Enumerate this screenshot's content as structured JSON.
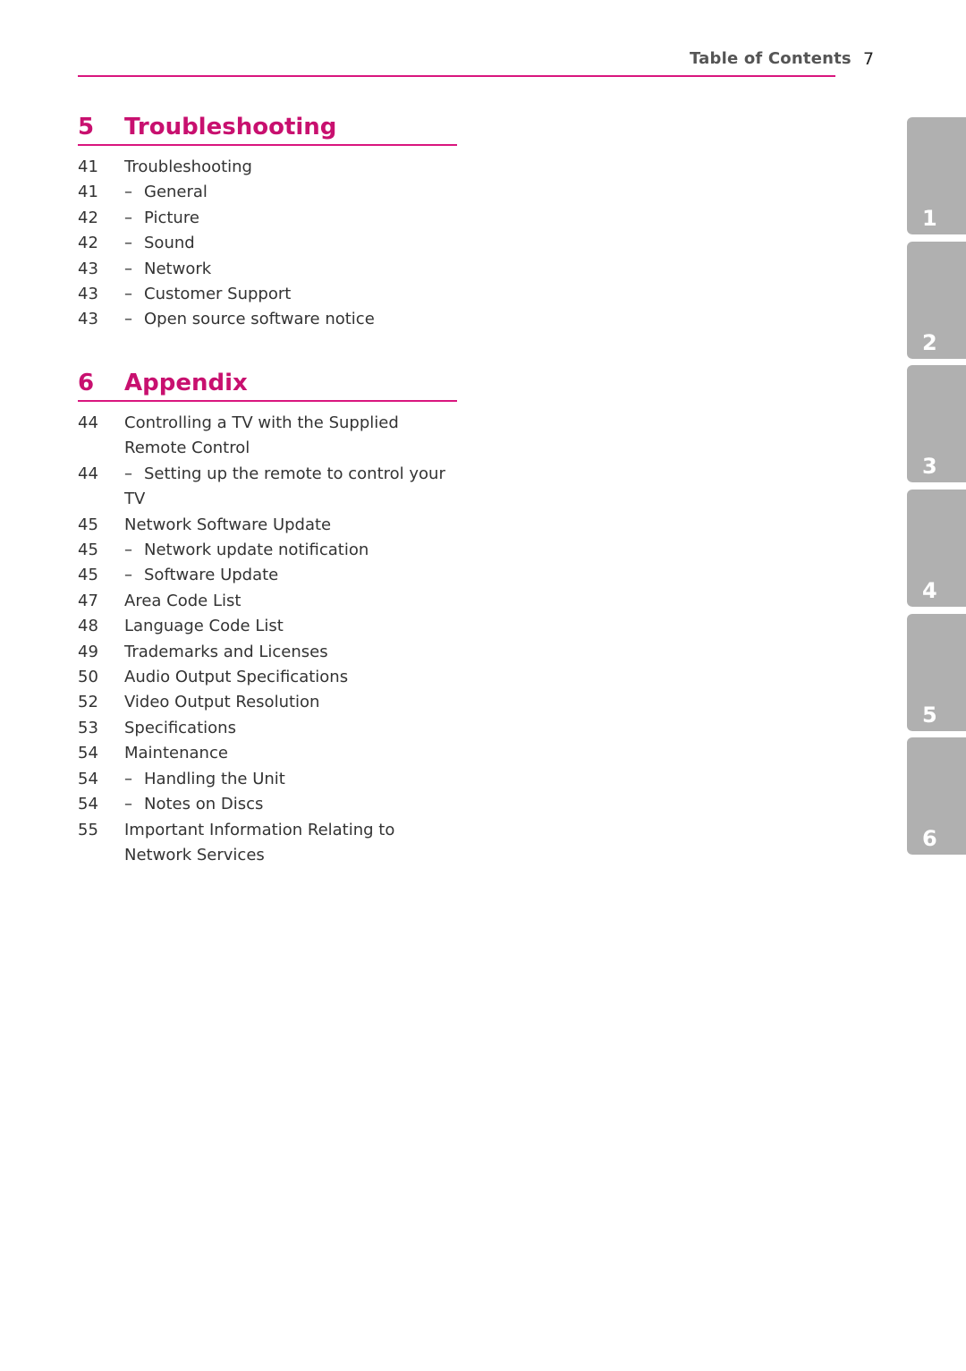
{
  "header": {
    "title": "Table of Contents",
    "page_number": "7"
  },
  "sections": [
    {
      "number": "5",
      "title": "Troubleshooting",
      "entries": [
        {
          "page": "41",
          "text": "Troubleshooting",
          "sub": false
        },
        {
          "page": "41",
          "text": "General",
          "sub": true
        },
        {
          "page": "42",
          "text": "Picture",
          "sub": true
        },
        {
          "page": "42",
          "text": "Sound",
          "sub": true
        },
        {
          "page": "43",
          "text": "Network",
          "sub": true
        },
        {
          "page": "43",
          "text": "Customer Support",
          "sub": true
        },
        {
          "page": "43",
          "text": "Open source software notice",
          "sub": true
        }
      ]
    },
    {
      "number": "6",
      "title": "Appendix",
      "entries": [
        {
          "page": "44",
          "text": "Controlling a TV with the Supplied Remote Control",
          "sub": false
        },
        {
          "page": "44",
          "text": "Setting up the remote to control your TV",
          "sub": true
        },
        {
          "page": "45",
          "text": "Network Software Update",
          "sub": false
        },
        {
          "page": "45",
          "text": "Network update notification",
          "sub": true
        },
        {
          "page": "45",
          "text": "Software Update",
          "sub": true
        },
        {
          "page": "47",
          "text": "Area Code List",
          "sub": false
        },
        {
          "page": "48",
          "text": "Language Code List",
          "sub": false
        },
        {
          "page": "49",
          "text": "Trademarks and Licenses",
          "sub": false
        },
        {
          "page": "50",
          "text": "Audio Output Specifications",
          "sub": false
        },
        {
          "page": "52",
          "text": "Video Output Resolution",
          "sub": false
        },
        {
          "page": "53",
          "text": "Specifications",
          "sub": false
        },
        {
          "page": "54",
          "text": "Maintenance",
          "sub": false
        },
        {
          "page": "54",
          "text": "Handling the Unit",
          "sub": true
        },
        {
          "page": "54",
          "text": "Notes on Discs",
          "sub": true
        },
        {
          "page": "55",
          "text": "Important Information Relating to Network Services",
          "sub": false
        }
      ]
    }
  ],
  "dash": "–",
  "chapter_tabs": [
    "1",
    "2",
    "3",
    "4",
    "5",
    "6"
  ]
}
